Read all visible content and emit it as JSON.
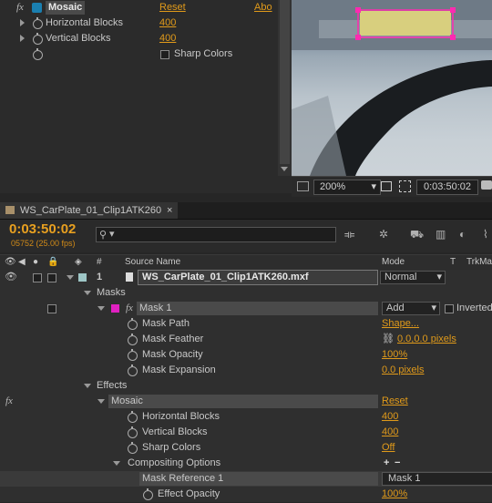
{
  "effect_controls": {
    "effect_name": "Mosaic",
    "reset_label": "Reset",
    "about_label": "Abo",
    "params": [
      {
        "name": "Horizontal Blocks",
        "value": "400"
      },
      {
        "name": "Vertical Blocks",
        "value": "400"
      }
    ],
    "sharp_colors_label": "Sharp Colors"
  },
  "viewer": {
    "zoom": "200%",
    "timecode": "0:03:50:02",
    "mask_color": "#ff2ab0"
  },
  "timeline": {
    "tab_label": "WS_CarPlate_01_Clip1ATK260",
    "current_time": "0:03:50:02",
    "frame_info": "05752 (25.00 fps)",
    "search_placeholder": "",
    "columns": {
      "number": "#",
      "source_name": "Source Name",
      "mode": "Mode",
      "t": "T",
      "trkmat": "TrkMat"
    },
    "layer": {
      "number": "1",
      "name": "WS_CarPlate_01_Clip1ATK260.mxf",
      "mode": "Normal"
    },
    "masks_label": "Masks",
    "mask": {
      "name": "Mask 1",
      "mode": "Add",
      "inverted_label": "Inverted",
      "color": "#e020c0"
    },
    "mask_props": [
      {
        "name": "Mask Path",
        "value": "Shape..."
      },
      {
        "name": "Mask Feather",
        "value": "0.0,0.0 pixels"
      },
      {
        "name": "Mask Opacity",
        "value": "100%"
      },
      {
        "name": "Mask Expansion",
        "value": "0.0 pixels"
      }
    ],
    "effects_label": "Effects",
    "effect": {
      "name": "Mosaic",
      "reset": "Reset"
    },
    "effect_props": [
      {
        "name": "Horizontal Blocks",
        "value": "400"
      },
      {
        "name": "Vertical Blocks",
        "value": "400"
      },
      {
        "name": "Sharp Colors",
        "value": "Off"
      }
    ],
    "compositing_label": "Compositing Options",
    "mask_reference": {
      "name": "Mask Reference 1",
      "value": "Mask 1"
    },
    "effect_opacity": {
      "name": "Effect Opacity",
      "value": "100%"
    }
  }
}
